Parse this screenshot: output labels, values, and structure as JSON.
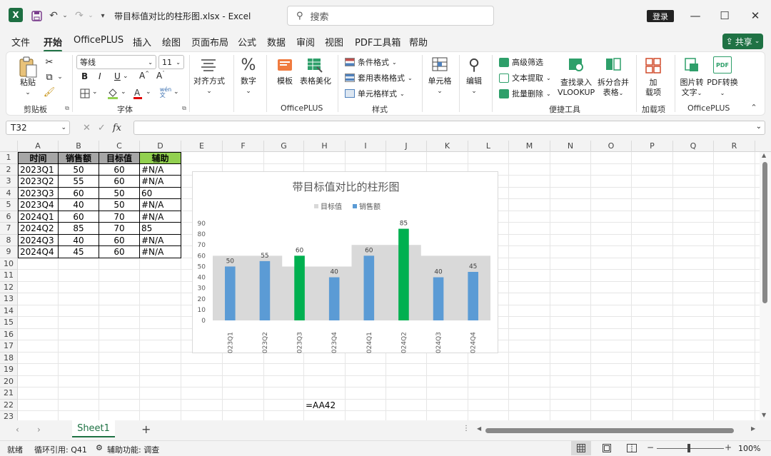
{
  "title_bar": {
    "logo_letter": "X",
    "doc_title": "带目标值对比的柱形图.xlsx  -  Excel",
    "search_placeholder": "搜索",
    "login_label": "登录"
  },
  "menu": {
    "tabs": [
      "文件",
      "开始",
      "OfficePLUS",
      "插入",
      "绘图",
      "页面布局",
      "公式",
      "数据",
      "审阅",
      "视图",
      "PDF工具箱",
      "帮助"
    ],
    "active": "开始",
    "share_label": "共享"
  },
  "ribbon": {
    "paste": "粘贴",
    "font_name": "等线",
    "font_size": "11",
    "bold": "B",
    "italic": "I",
    "underline": "U",
    "grow": "A",
    "shrink": "A",
    "align": "对齐方式",
    "number": "数字",
    "template": "模板",
    "beautify": "表格美化",
    "cond_format": "条件格式",
    "table_format": "套用表格格式",
    "cell_style": "单元格样式",
    "cells": "单元格",
    "edit": "编辑",
    "adv_filter": "高级筛选",
    "text_extract": "文本提取",
    "batch_delete": "批量删除",
    "lookup_a": "查找录入",
    "lookup_b": "VLOOKUP",
    "split_a": "拆分合并",
    "split_b": "表格",
    "addin_a": "加",
    "addin_b": "载项",
    "img_a": "图片转",
    "img_b": "文字",
    "pdf": "PDF转换",
    "groups": {
      "clipboard": "剪贴板",
      "font": "字体",
      "officeplus": "OfficePLUS",
      "styles": "样式",
      "tools": "便捷工具",
      "addins": "加载项",
      "officeplus2": "OfficePLUS"
    }
  },
  "formula_bar": {
    "name_box": "T32",
    "fx": "fx",
    "content": ""
  },
  "columns": [
    "A",
    "B",
    "C",
    "D",
    "E",
    "F",
    "G",
    "H",
    "I",
    "J",
    "K",
    "L",
    "M",
    "N",
    "O",
    "P",
    "Q",
    "R"
  ],
  "rows": [
    "1",
    "2",
    "3",
    "4",
    "5",
    "6",
    "7",
    "8",
    "9",
    "10",
    "11",
    "12",
    "13",
    "14",
    "15",
    "16",
    "17",
    "18",
    "19",
    "20",
    "21",
    "22",
    "23"
  ],
  "table": {
    "headers": [
      "时间",
      "销售额",
      "目标值",
      "辅助"
    ],
    "rows": [
      [
        "2023Q1",
        "50",
        "60",
        "#N/A"
      ],
      [
        "2023Q2",
        "55",
        "60",
        "#N/A"
      ],
      [
        "2023Q3",
        "60",
        "50",
        "60"
      ],
      [
        "2023Q4",
        "40",
        "50",
        "#N/A"
      ],
      [
        "2024Q1",
        "60",
        "70",
        "#N/A"
      ],
      [
        "2024Q2",
        "85",
        "70",
        "85"
      ],
      [
        "2024Q3",
        "40",
        "60",
        "#N/A"
      ],
      [
        "2024Q4",
        "45",
        "60",
        "#N/A"
      ]
    ]
  },
  "cell_h22": "=AA42",
  "chart_data": {
    "type": "bar",
    "title": "带目标值对比的柱形图",
    "categories": [
      "2023Q1",
      "2023Q2",
      "2023Q3",
      "2023Q4",
      "2024Q1",
      "2024Q2",
      "2024Q3",
      "2024Q4"
    ],
    "series": [
      {
        "name": "目标值",
        "values": [
          60,
          60,
          50,
          50,
          70,
          70,
          60,
          60
        ],
        "color": "#d9d9d9",
        "style": "area-step"
      },
      {
        "name": "销售额",
        "values": [
          50,
          55,
          60,
          40,
          60,
          85,
          40,
          45
        ],
        "color": "#5b9bd5"
      },
      {
        "name": "辅助",
        "values": [
          null,
          null,
          60,
          null,
          null,
          85,
          null,
          null
        ],
        "color": "#00b050"
      }
    ],
    "data_labels": [
      "50",
      "55",
      "60",
      "40",
      "60",
      "85",
      "40",
      "45"
    ],
    "yticks": [
      "0",
      "10",
      "20",
      "30",
      "40",
      "50",
      "60",
      "70",
      "80",
      "90"
    ],
    "ylim": [
      0,
      90
    ],
    "legend": [
      "目标值",
      "销售额"
    ],
    "legend_position": "top",
    "grid": false
  },
  "sheets": [
    "Sheet1"
  ],
  "active_sheet": "Sheet1",
  "status": {
    "ready": "就绪",
    "circular": "循环引用: Q41",
    "accessibility": "辅助功能: 调查",
    "zoom": "100%"
  },
  "colors": {
    "accent": "#217346",
    "table_header": "#a6a6a6",
    "helper_header": "#92d050"
  }
}
